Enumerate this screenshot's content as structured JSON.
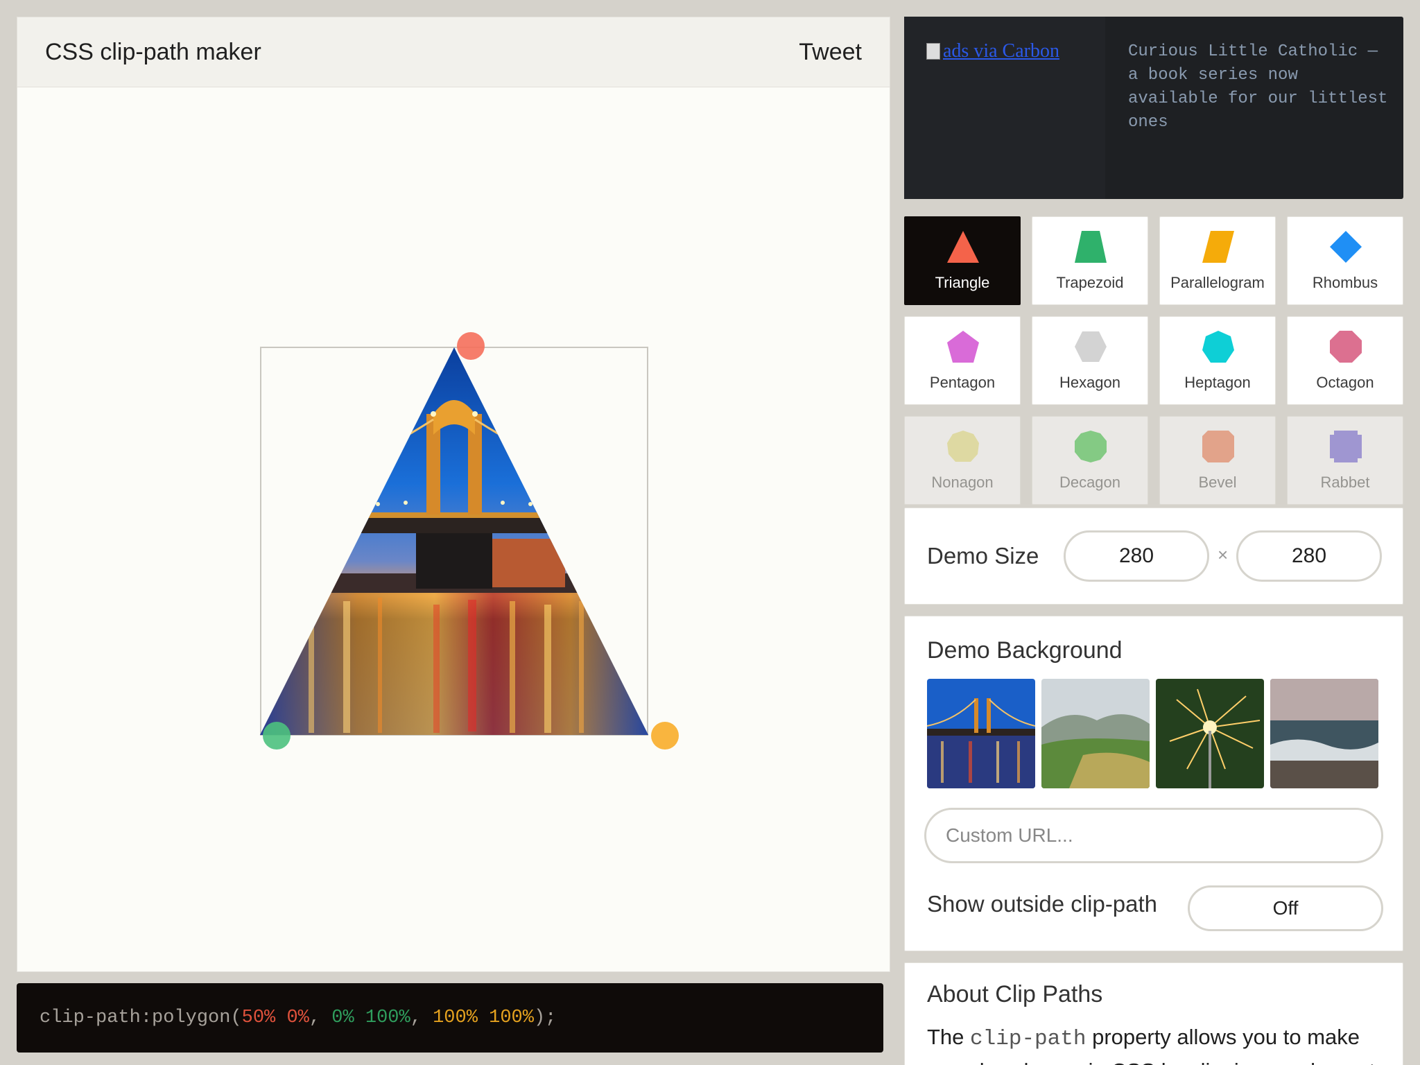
{
  "header": {
    "title": "CSS clip-path maker",
    "tweet_label": "Tweet"
  },
  "code": {
    "property": "clip-path:",
    "func": "polygon(",
    "p1": "50% 0%",
    "p2": "0% 100%",
    "p3": "100% 100%",
    "close": ");"
  },
  "ad": {
    "alt_text": "ads via Carbon",
    "text": "Curious Little Catholic — a book series now available for our littlest ones"
  },
  "shapes": [
    {
      "label": "Triangle",
      "color": "#f4634a",
      "active": true
    },
    {
      "label": "Trapezoid",
      "color": "#2fb16b",
      "active": false
    },
    {
      "label": "Parallelogram",
      "color": "#f5ab0a",
      "active": false
    },
    {
      "label": "Rhombus",
      "color": "#1f8ff5",
      "active": false
    },
    {
      "label": "Pentagon",
      "color": "#d96bd8",
      "active": false
    },
    {
      "label": "Hexagon",
      "color": "#d3d3d3",
      "active": false
    },
    {
      "label": "Heptagon",
      "color": "#0ecfd6",
      "active": false
    },
    {
      "label": "Octagon",
      "color": "#dc7090",
      "active": false
    },
    {
      "label": "Nonagon",
      "color": "#e7e07b",
      "active": false
    },
    {
      "label": "Decagon",
      "color": "#35c43f",
      "active": false
    },
    {
      "label": "Bevel",
      "color": "#f0754b",
      "active": false
    },
    {
      "label": "Rabbet",
      "color": "#6b5bd8",
      "active": false
    }
  ],
  "demo_size": {
    "label": "Demo Size",
    "width": "280",
    "height": "280",
    "separator": "×"
  },
  "demo_background": {
    "title": "Demo Background",
    "url_placeholder": "Custom URL...",
    "outside_label": "Show outside clip-path",
    "outside_value": "Off"
  },
  "about": {
    "title": "About Clip Paths",
    "text_pre": "The ",
    "code": "clip-path",
    "text_post": " property allows you to make complex shapes in CSS by clipping an element"
  },
  "handle_colors": {
    "top": "#f56f5b",
    "bottom_left": "#4cc17e",
    "bottom_right": "#f8ad2a"
  }
}
